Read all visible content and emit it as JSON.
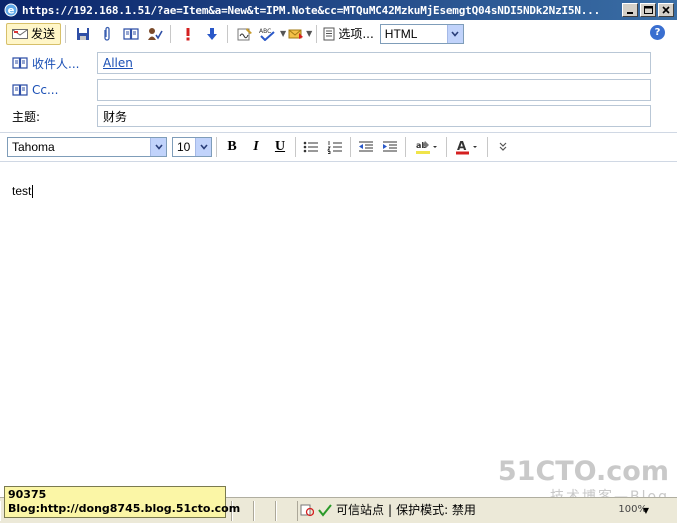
{
  "titlebar": {
    "url": "https://192.168.1.51/?ae=Item&a=New&t=IPM.Note&cc=MTQuMC42MzkuMjEsemgtQ04sNDI5NDk2NzI5N..."
  },
  "toolbar": {
    "send_label": "发送",
    "options_label": "选项...",
    "format_value": "HTML"
  },
  "header": {
    "to_label": "收件人...",
    "to_value": "Allen",
    "cc_label": "Cc...",
    "cc_value": "",
    "subject_label": "主题:",
    "subject_value": "财务"
  },
  "format_bar": {
    "font_name": "Tahoma",
    "font_size": "10",
    "bold": "B",
    "italic": "I",
    "underline": "U",
    "font_color_glyph": "A",
    "highlight_glyph": "ab"
  },
  "body": {
    "text": "test"
  },
  "statusbar": {
    "zone_label": "可信站点",
    "separator": "|",
    "protected_mode": "保护模式: 禁用",
    "zoom": "100%"
  },
  "tooltip": {
    "line1": "90375",
    "line2": "Blog:http://dong8745.blog.51cto.com"
  },
  "watermark": {
    "brand": "51CTO.com",
    "sub": "技术博客",
    "blog": "Blog"
  },
  "colors": {
    "title_gradient_start": "#0a246a",
    "title_gradient_end": "#3a6ea5",
    "link_blue": "#1a4fb5",
    "send_button_bg": "#fff6c8",
    "tooltip_bg": "#fbf6a6"
  }
}
